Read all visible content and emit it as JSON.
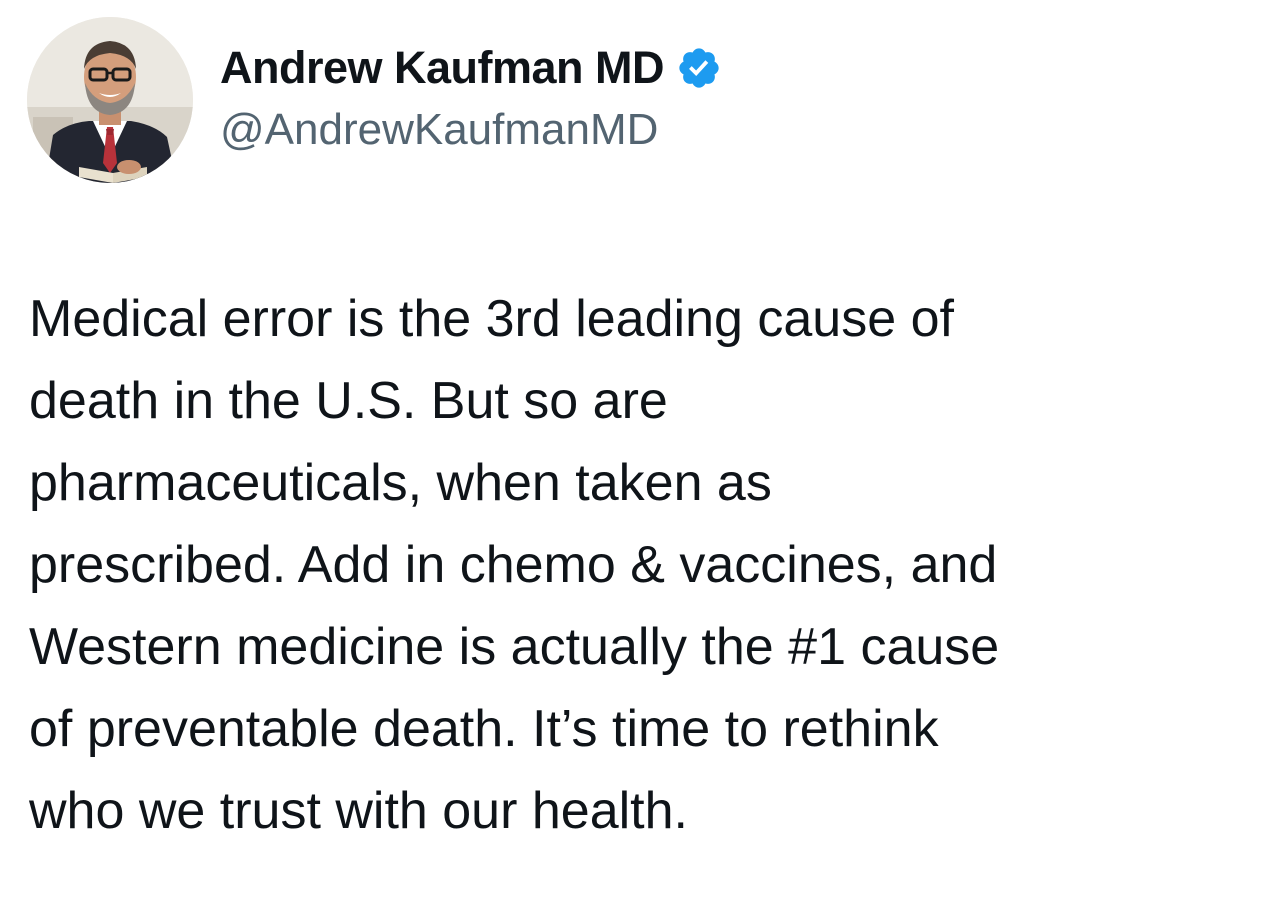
{
  "author": {
    "display_name": "Andrew Kaufman MD",
    "handle": "@AndrewKaufmanMD",
    "verified": true,
    "avatar_icon": "profile-photo",
    "verified_icon": "verified-badge-icon",
    "verified_color": "#1d9bf0"
  },
  "tweet": {
    "lines": [
      "Medical error is the 3rd leading cause of",
      "death in the U.S. But so are",
      "pharmaceuticals, when taken as",
      "prescribed. Add in chemo & vaccines, and",
      "Western medicine is actually the #1 cause",
      "of preventable death. It’s time to rethink",
      "who we trust with our health."
    ]
  }
}
